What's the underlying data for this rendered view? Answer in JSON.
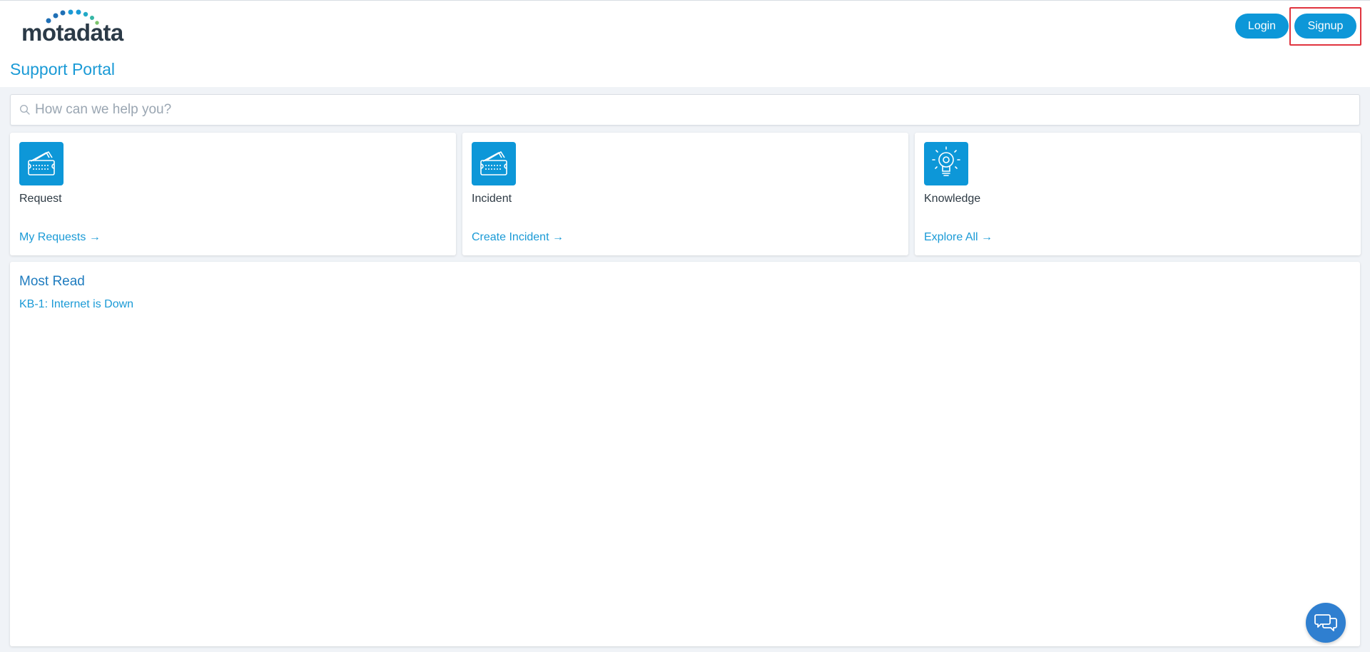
{
  "header": {
    "logo_text": "motadata",
    "login_label": "Login",
    "signup_label": "Signup"
  },
  "page": {
    "title": "Support Portal"
  },
  "search": {
    "placeholder": "How can we help you?"
  },
  "cards": [
    {
      "title": "Request",
      "link": "My Requests →",
      "icon": "ticket-icon"
    },
    {
      "title": "Incident",
      "link": "Create Incident →",
      "icon": "ticket-icon"
    },
    {
      "title": "Knowledge",
      "link": "Explore All →",
      "icon": "lightbulb-icon"
    }
  ],
  "most_read": {
    "title": "Most Read",
    "items": [
      "KB-1: Internet is Down"
    ]
  },
  "colors": {
    "accent": "#0d97d8",
    "title": "#1a9ad6",
    "highlight": "#e0343f",
    "chat": "#2f7fd0"
  }
}
